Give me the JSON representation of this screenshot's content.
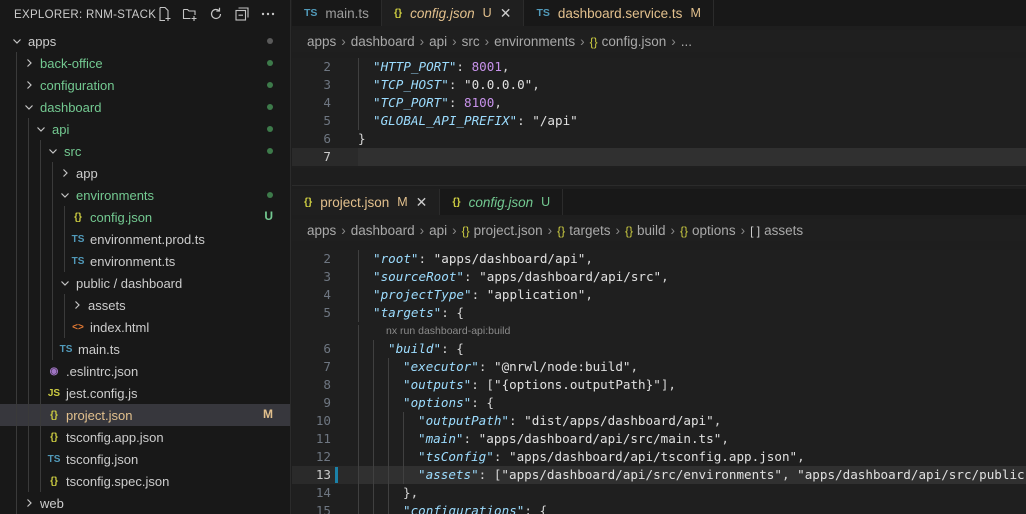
{
  "explorer": {
    "title": "EXPLORER: RNM-STACK",
    "actions": [
      "new-file",
      "new-folder",
      "refresh",
      "collapse-all",
      "more"
    ],
    "tree": [
      {
        "label": "apps",
        "type": "folder-open",
        "depth": 0,
        "dot": "gray"
      },
      {
        "label": "back-office",
        "type": "folder-closed",
        "depth": 1,
        "dot": "green",
        "color": "#73c991"
      },
      {
        "label": "configuration",
        "type": "folder-closed",
        "depth": 1,
        "dot": "green",
        "color": "#73c991"
      },
      {
        "label": "dashboard",
        "type": "folder-open",
        "depth": 1,
        "dot": "green",
        "color": "#73c991"
      },
      {
        "label": "api",
        "type": "folder-open",
        "depth": 2,
        "dot": "green",
        "color": "#73c991"
      },
      {
        "label": "src",
        "type": "folder-open",
        "depth": 3,
        "dot": "green",
        "color": "#73c991"
      },
      {
        "label": "app",
        "type": "folder-closed",
        "depth": 4
      },
      {
        "label": "environments",
        "type": "folder-open",
        "depth": 4,
        "dot": "green",
        "color": "#73c991"
      },
      {
        "label": "config.json",
        "type": "file",
        "depth": 5,
        "icon": "{}",
        "iconColor": "#cbcb41",
        "badge": "U",
        "badgeColor": "#73c991",
        "color": "#73c991"
      },
      {
        "label": "environment.prod.ts",
        "type": "file",
        "depth": 5,
        "icon": "TS",
        "iconColor": "#519aba"
      },
      {
        "label": "environment.ts",
        "type": "file",
        "depth": 5,
        "icon": "TS",
        "iconColor": "#519aba"
      },
      {
        "label": "public / dashboard",
        "type": "folder-open",
        "depth": 4
      },
      {
        "label": "assets",
        "type": "folder-closed",
        "depth": 5
      },
      {
        "label": "index.html",
        "type": "file",
        "depth": 5,
        "icon": "<>",
        "iconColor": "#e37933"
      },
      {
        "label": "main.ts",
        "type": "file",
        "depth": 4,
        "icon": "TS",
        "iconColor": "#519aba"
      },
      {
        "label": ".eslintrc.json",
        "type": "file",
        "depth": 3,
        "icon": "◉",
        "iconColor": "#a074c4"
      },
      {
        "label": "jest.config.js",
        "type": "file",
        "depth": 3,
        "icon": "JS",
        "iconColor": "#cbcb41"
      },
      {
        "label": "project.json",
        "type": "file",
        "depth": 3,
        "icon": "{}",
        "iconColor": "#cbcb41",
        "badge": "M",
        "badgeColor": "#e2c08d",
        "color": "#e2c08d",
        "active": true
      },
      {
        "label": "tsconfig.app.json",
        "type": "file",
        "depth": 3,
        "icon": "{}",
        "iconColor": "#cbcb41"
      },
      {
        "label": "tsconfig.json",
        "type": "file",
        "depth": 3,
        "icon": "TS",
        "iconColor": "#519aba"
      },
      {
        "label": "tsconfig.spec.json",
        "type": "file",
        "depth": 3,
        "icon": "{}",
        "iconColor": "#cbcb41"
      },
      {
        "label": "web",
        "type": "folder-closed",
        "depth": 1
      }
    ]
  },
  "top_group": {
    "tabs": [
      {
        "icon": "TS",
        "iconColor": "#519aba",
        "label": "main.ts",
        "labelColor": "#9d9d9d",
        "badge": "",
        "italic": false,
        "active": false
      },
      {
        "icon": "{}",
        "iconColor": "#cbcb41",
        "label": "config.json",
        "labelColor": "#e2c08d",
        "badge": "U",
        "italic": true,
        "active": true,
        "close": "✕"
      },
      {
        "icon": "TS",
        "iconColor": "#519aba",
        "label": "dashboard.service.ts",
        "labelColor": "#e2c08d",
        "badge": "M",
        "italic": false,
        "active": false
      }
    ],
    "breadcrumb": [
      "apps",
      "dashboard",
      "api",
      "src",
      "environments",
      "config.json",
      "..."
    ],
    "lines": [
      {
        "n": "2",
        "html": [
          [
            "k",
            "\"HTTP_PORT\""
          ],
          [
            "p",
            ": "
          ],
          [
            "num",
            "8001"
          ],
          [
            "p",
            ","
          ]
        ],
        "indent": 1
      },
      {
        "n": "3",
        "html": [
          [
            "k",
            "\"TCP_HOST\""
          ],
          [
            "p",
            ": "
          ],
          [
            "str",
            "\"0.0.0.0\""
          ],
          [
            "p",
            ","
          ]
        ],
        "indent": 1
      },
      {
        "n": "4",
        "html": [
          [
            "k",
            "\"TCP_PORT\""
          ],
          [
            "p",
            ": "
          ],
          [
            "num",
            "8100"
          ],
          [
            "p",
            ","
          ]
        ],
        "indent": 1
      },
      {
        "n": "5",
        "html": [
          [
            "k",
            "\"GLOBAL_API_PREFIX\""
          ],
          [
            "p",
            ": "
          ],
          [
            "str",
            "\"/api\""
          ]
        ],
        "indent": 1
      },
      {
        "n": "6",
        "html": [
          [
            "p",
            "}"
          ]
        ],
        "indent": 0
      },
      {
        "n": "7",
        "html": [],
        "indent": 0,
        "current": true
      }
    ]
  },
  "bottom_group": {
    "tabs": [
      {
        "icon": "{}",
        "iconColor": "#cbcb41",
        "label": "project.json",
        "labelColor": "#e2c08d",
        "badge": "M",
        "italic": false,
        "active": true,
        "close": "✕"
      },
      {
        "icon": "{}",
        "iconColor": "#cbcb41",
        "label": "config.json",
        "labelColor": "#73c991",
        "badge": "U",
        "italic": true,
        "active": false
      }
    ],
    "breadcrumb": [
      "apps",
      "dashboard",
      "api",
      "project.json",
      "targets",
      "build",
      "options",
      "assets"
    ],
    "codelens": "nx run dashboard-api:build",
    "lines": [
      {
        "n": "2",
        "html": [
          [
            "k",
            "\"root\""
          ],
          [
            "p",
            ": "
          ],
          [
            "str",
            "\"apps/dashboard/api\""
          ],
          [
            "p",
            ","
          ]
        ],
        "indent": 1
      },
      {
        "n": "3",
        "html": [
          [
            "k",
            "\"sourceRoot\""
          ],
          [
            "p",
            ": "
          ],
          [
            "str",
            "\"apps/dashboard/api/src\""
          ],
          [
            "p",
            ","
          ]
        ],
        "indent": 1
      },
      {
        "n": "4",
        "html": [
          [
            "k",
            "\"projectType\""
          ],
          [
            "p",
            ": "
          ],
          [
            "str",
            "\"application\""
          ],
          [
            "p",
            ","
          ]
        ],
        "indent": 1
      },
      {
        "n": "5",
        "html": [
          [
            "k",
            "\"targets\""
          ],
          [
            "p",
            ": {"
          ]
        ],
        "indent": 1
      },
      {
        "n": "6",
        "html": [
          [
            "k",
            "\"build\""
          ],
          [
            "p",
            ": {"
          ]
        ],
        "indent": 2
      },
      {
        "n": "7",
        "html": [
          [
            "k",
            "\"executor\""
          ],
          [
            "p",
            ": "
          ],
          [
            "str",
            "\"@nrwl/node:build\""
          ],
          [
            "p",
            ","
          ]
        ],
        "indent": 3
      },
      {
        "n": "8",
        "html": [
          [
            "k",
            "\"outputs\""
          ],
          [
            "p",
            ": ["
          ],
          [
            "str",
            "\"{options.outputPath}\""
          ],
          [
            "p",
            "],"
          ]
        ],
        "indent": 3
      },
      {
        "n": "9",
        "html": [
          [
            "k",
            "\"options\""
          ],
          [
            "p",
            ": {"
          ]
        ],
        "indent": 3
      },
      {
        "n": "10",
        "html": [
          [
            "k",
            "\"outputPath\""
          ],
          [
            "p",
            ": "
          ],
          [
            "str",
            "\"dist/apps/dashboard/api\""
          ],
          [
            "p",
            ","
          ]
        ],
        "indent": 4
      },
      {
        "n": "11",
        "html": [
          [
            "k",
            "\"main\""
          ],
          [
            "p",
            ": "
          ],
          [
            "str",
            "\"apps/dashboard/api/src/main.ts\""
          ],
          [
            "p",
            ","
          ]
        ],
        "indent": 4
      },
      {
        "n": "12",
        "html": [
          [
            "k",
            "\"tsConfig\""
          ],
          [
            "p",
            ": "
          ],
          [
            "str",
            "\"apps/dashboard/api/tsconfig.app.json\""
          ],
          [
            "p",
            ","
          ]
        ],
        "indent": 4
      },
      {
        "n": "13",
        "html": [
          [
            "k",
            "\"assets\""
          ],
          [
            "p",
            ": ["
          ],
          [
            "str",
            "\"apps/dashboard/api/src/environments\""
          ],
          [
            "p",
            ", "
          ],
          [
            "str",
            "\"apps/dashboard/api/src/public\""
          ],
          [
            "p",
            "]"
          ]
        ],
        "indent": 4,
        "current": true
      },
      {
        "n": "14",
        "html": [
          [
            "p",
            "},"
          ]
        ],
        "indent": 3
      },
      {
        "n": "15",
        "html": [
          [
            "k",
            "\"configurations\""
          ],
          [
            "p",
            ": {"
          ]
        ],
        "indent": 3
      }
    ]
  }
}
